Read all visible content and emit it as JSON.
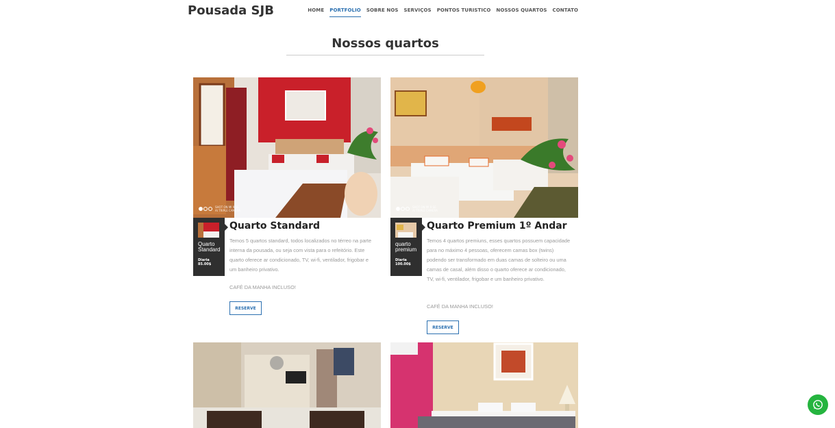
{
  "brand": "Pousada SJB",
  "nav": [
    {
      "label": "HOME",
      "active": false
    },
    {
      "label": "PORTFOLIO",
      "active": true
    },
    {
      "label": "SOBRE NOS",
      "active": false
    },
    {
      "label": "SERVIÇOS",
      "active": false
    },
    {
      "label": "PONTOS TURISTICO",
      "active": false
    },
    {
      "label": "NOSSOS QUARTOS",
      "active": false
    },
    {
      "label": "CONTATO",
      "active": false
    }
  ],
  "section_title": "Nossos quartos",
  "rooms": [
    {
      "name": "Quarto Standard",
      "side_name": "Quarto Standard",
      "price_label": "Diaria",
      "price": "85.00$",
      "description": "Temos 5 quartos standard, todos localizados no térreo na parte interna da pousada, ou seja com vista para o refeitório. Este quarto oferece ar condicionado, TV, wi-fi, ventilador, frigobar e um banheiro privativo.",
      "included": "CAFÉ DA MANHA INCLUSO!",
      "button": "RESERVE",
      "photo_caption": "SHOT ON MI 9 SE\nAI TRIPLE CAMERA"
    },
    {
      "name": "Quarto Premium 1º Andar",
      "side_name": "quarto premium",
      "price_label": "Diaria",
      "price": "100.00$",
      "description": "Temos 4 quartos premiuns, esses quartos possuem capacidade para no máximo 4 pessoas, oferecem camas box (twins) podendo ser transformado em duas camas de solteiro ou uma camas de casal, além disso o quarto oferece ar condicionado, TV, wi-fi, ventilador, frigobar e um banheiro privativo.",
      "included": "CAFÉ DA MANHA INCLUSO!",
      "button": "RESERVE",
      "photo_caption": "SHOT ON MI 9 SE\nAI TRIPLE CAMERA"
    }
  ],
  "whatsapp_icon": "whatsapp-icon",
  "colors": {
    "accent": "#2a6fb0",
    "sidebar": "#2f2f2f",
    "whatsapp": "#25b43f"
  }
}
